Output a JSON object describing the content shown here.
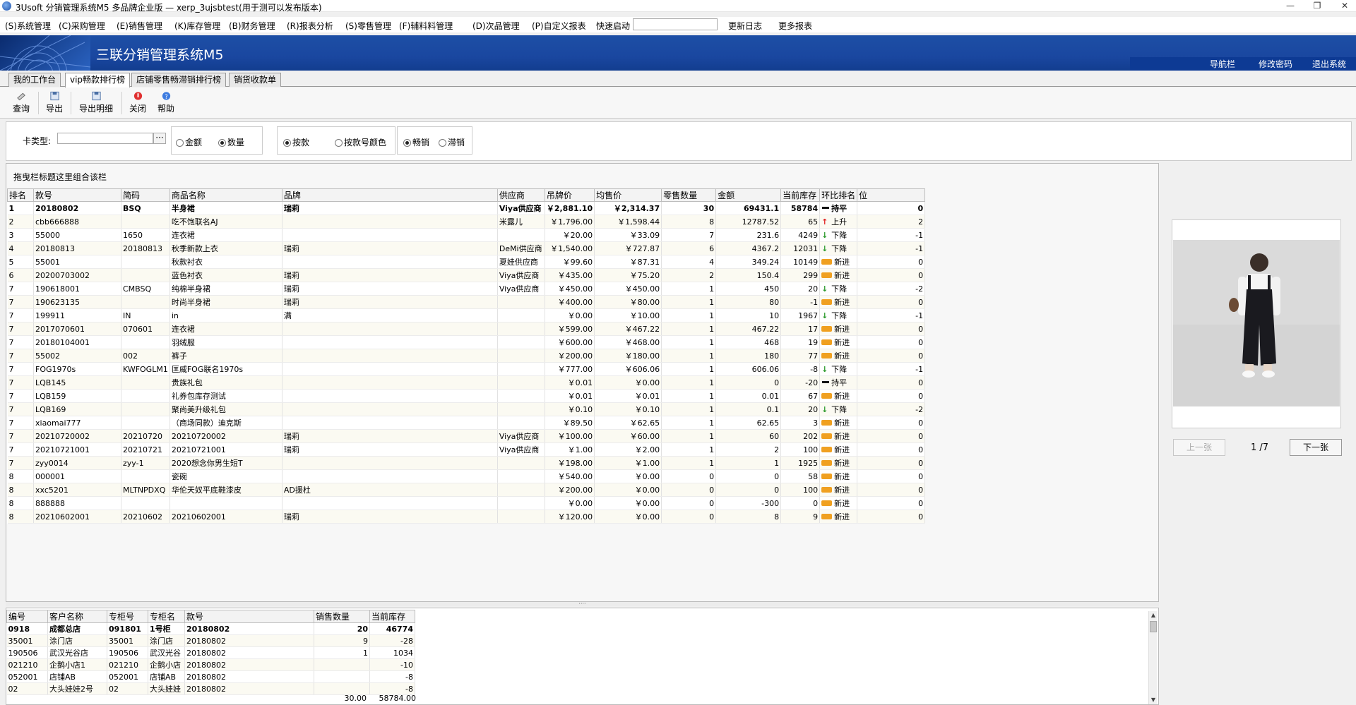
{
  "window": {
    "title": "3Usoft 分销管理系统M5 多品牌企业版 — xerp_3ujsbtest(用于测可以发布版本)",
    "controls": [
      "—",
      "❐",
      "✕"
    ]
  },
  "menu": {
    "items": [
      "(S)系统管理",
      "(C)采购管理",
      "(E)销售管理",
      "(K)库存管理",
      "(B)财务管理",
      "(R)报表分析",
      "(S)零售管理",
      "(F)辅料料管理",
      "(D)次品管理",
      "(P)自定义报表"
    ],
    "quick_start_label": "快速启动",
    "quick_start_value": "",
    "update_log": "更新日志",
    "more_reports": "更多报表"
  },
  "banner": {
    "title": "三联分销管理系统M5",
    "links": [
      "导航栏",
      "修改密码",
      "退出系统"
    ]
  },
  "tabs": [
    "我的工作台",
    "vip畅款排行榜",
    "店铺零售畅滞销排行榜",
    "销货收款单"
  ],
  "toolbar": [
    "查询",
    "导出",
    "导出明细",
    "关闭",
    "帮助"
  ],
  "filter": {
    "card_type_label": "卡类型:",
    "card_type_value": "",
    "browse": "···",
    "metric": [
      "金额",
      "数量"
    ],
    "metric_selected": "数量",
    "grouping": [
      "按款",
      "按款号颜色"
    ],
    "grouping_selected": "按款",
    "sales": [
      "畅销",
      "滞销"
    ],
    "sales_selected": "畅销"
  },
  "main": {
    "group_hint": "拖曳栏标题这里组合该栏",
    "columns": [
      "排名",
      "款号",
      "简码",
      "商品名称",
      "品牌",
      "供应商",
      "吊牌价",
      "均售价",
      "零售数量",
      "金额",
      "当前库存",
      "环比排名",
      "位"
    ],
    "rows": [
      [
        "1",
        "20180802",
        "BSQ",
        "半身裙",
        "瑞莉",
        "Viya供应商",
        "￥2,881.10",
        "￥2,314.37",
        "30",
        "69431.1",
        "58784",
        "flat",
        "持平",
        "0"
      ],
      [
        "2",
        "cbb666888",
        "",
        "吃不饱联名AJ",
        "",
        "米露儿",
        "￥1,796.00",
        "￥1,598.44",
        "8",
        "12787.52",
        "65",
        "up",
        "上升",
        "2"
      ],
      [
        "3",
        "55000",
        "1650",
        "连衣裙",
        "",
        "",
        "￥20.00",
        "￥33.09",
        "7",
        "231.6",
        "4249",
        "down",
        "下降",
        "-1"
      ],
      [
        "4",
        "20180813",
        "20180813",
        "秋季新款上衣",
        "瑞莉",
        "DeMi供应商",
        "￥1,540.00",
        "￥727.87",
        "6",
        "4367.2",
        "12031",
        "down",
        "下降",
        "-1"
      ],
      [
        "5",
        "55001",
        "",
        "秋款衬衣",
        "",
        "夏娃供应商",
        "￥99.60",
        "￥87.31",
        "4",
        "349.24",
        "10149",
        "new",
        "新进",
        "0"
      ],
      [
        "6",
        "20200703002",
        "",
        "蓝色衬衣",
        "瑞莉",
        "Viya供应商",
        "￥435.00",
        "￥75.20",
        "2",
        "150.4",
        "299",
        "new",
        "新进",
        "0"
      ],
      [
        "7",
        "190618001",
        "CMBSQ",
        "纯棉半身裙",
        "瑞莉",
        "Viya供应商",
        "￥450.00",
        "￥450.00",
        "1",
        "450",
        "20",
        "down",
        "下降",
        "-2"
      ],
      [
        "7",
        "190623135",
        "",
        "时尚半身裙",
        "瑞莉",
        "",
        "￥400.00",
        "￥80.00",
        "1",
        "80",
        "-1",
        "new",
        "新进",
        "0"
      ],
      [
        "7",
        "199911",
        "IN",
        "in",
        "满",
        "",
        "￥0.00",
        "￥10.00",
        "1",
        "10",
        "1967",
        "down",
        "下降",
        "-1"
      ],
      [
        "7",
        "2017070601",
        "070601",
        "连衣裙",
        "",
        "",
        "￥599.00",
        "￥467.22",
        "1",
        "467.22",
        "17",
        "new",
        "新进",
        "0"
      ],
      [
        "7",
        "20180104001",
        "",
        "羽绒服",
        "",
        "",
        "￥600.00",
        "￥468.00",
        "1",
        "468",
        "19",
        "new",
        "新进",
        "0"
      ],
      [
        "7",
        "55002",
        "002",
        "裤子",
        "",
        "",
        "￥200.00",
        "￥180.00",
        "1",
        "180",
        "77",
        "new",
        "新进",
        "0"
      ],
      [
        "7",
        "FOG1970s",
        "KWFOGLM1",
        "匡威FOG联名1970s",
        "",
        "",
        "￥777.00",
        "￥606.06",
        "1",
        "606.06",
        "-8",
        "down",
        "下降",
        "-1"
      ],
      [
        "7",
        "LQB145",
        "",
        "贵族礼包",
        "",
        "",
        "￥0.01",
        "￥0.00",
        "1",
        "0",
        "-20",
        "flat",
        "持平",
        "0"
      ],
      [
        "7",
        "LQB159",
        "",
        "礼券包库存测试",
        "",
        "",
        "￥0.01",
        "￥0.01",
        "1",
        "0.01",
        "67",
        "new",
        "新进",
        "0"
      ],
      [
        "7",
        "LQB169",
        "",
        "聚尚美升级礼包",
        "",
        "",
        "￥0.10",
        "￥0.10",
        "1",
        "0.1",
        "20",
        "down",
        "下降",
        "-2"
      ],
      [
        "7",
        "xiaomai777",
        "",
        "（商场同款）迪克斯",
        "",
        "",
        "￥89.50",
        "￥62.65",
        "1",
        "62.65",
        "3",
        "new",
        "新进",
        "0"
      ],
      [
        "7",
        "20210720002",
        "20210720",
        "20210720002",
        "瑞莉",
        "Viya供应商",
        "￥100.00",
        "￥60.00",
        "1",
        "60",
        "202",
        "new",
        "新进",
        "0"
      ],
      [
        "7",
        "20210721001",
        "20210721",
        "20210721001",
        "瑞莉",
        "Viya供应商",
        "￥1.00",
        "￥2.00",
        "1",
        "2",
        "100",
        "new",
        "新进",
        "0"
      ],
      [
        "7",
        "zyy0014",
        "zyy-1",
        "2020想念你男生短T",
        "",
        "",
        "￥198.00",
        "￥1.00",
        "1",
        "1",
        "1925",
        "new",
        "新进",
        "0"
      ],
      [
        "8",
        "000001",
        "",
        "瓷碗",
        "",
        "",
        "￥540.00",
        "￥0.00",
        "0",
        "0",
        "58",
        "new",
        "新进",
        "0"
      ],
      [
        "8",
        "xxc5201",
        "MLTNPDXQ",
        "华伦天奴平底鞋漆皮",
        "AD援杜",
        "",
        "￥200.00",
        "￥0.00",
        "0",
        "0",
        "100",
        "new",
        "新进",
        "0"
      ],
      [
        "8",
        "888888",
        "",
        "",
        "",
        "",
        "￥0.00",
        "￥0.00",
        "0",
        "-300",
        "0",
        "new",
        "新进",
        "0"
      ],
      [
        "8",
        "20210602001",
        "20210602",
        "20210602001",
        "瑞莉",
        "",
        "￥120.00",
        "￥0.00",
        "0",
        "8",
        "9",
        "new",
        "新进",
        "0"
      ]
    ]
  },
  "detail": {
    "splitter": "····",
    "columns": [
      "编号",
      "客户名称",
      "专柜号",
      "专柜名",
      "款号",
      "销售数量",
      "当前库存"
    ],
    "rows": [
      [
        "0918",
        "成都总店",
        "091801",
        "1号柜",
        "20180802",
        "20",
        "46774"
      ],
      [
        "35001",
        "涂门店",
        "35001",
        "涂门店",
        "20180802",
        "9",
        "-28"
      ],
      [
        "190506",
        "武汉光谷店",
        "190506",
        "武汉光谷",
        "20180802",
        "1",
        "1034"
      ],
      [
        "021210",
        "企鹅小店1",
        "021210",
        "企鹅小店",
        "20180802",
        "",
        "-10"
      ],
      [
        "052001",
        "店铺AB",
        "052001",
        "店铺AB",
        "20180802",
        "",
        "-8"
      ],
      [
        "02",
        "大头娃娃2号",
        "02",
        "大头娃娃",
        "20180802",
        "",
        "-8"
      ]
    ],
    "sum_qty": "30.00",
    "sum_stock": "58784.00"
  },
  "viewer": {
    "prev": "上一张",
    "next": "下一张",
    "counter": "1 /7"
  }
}
